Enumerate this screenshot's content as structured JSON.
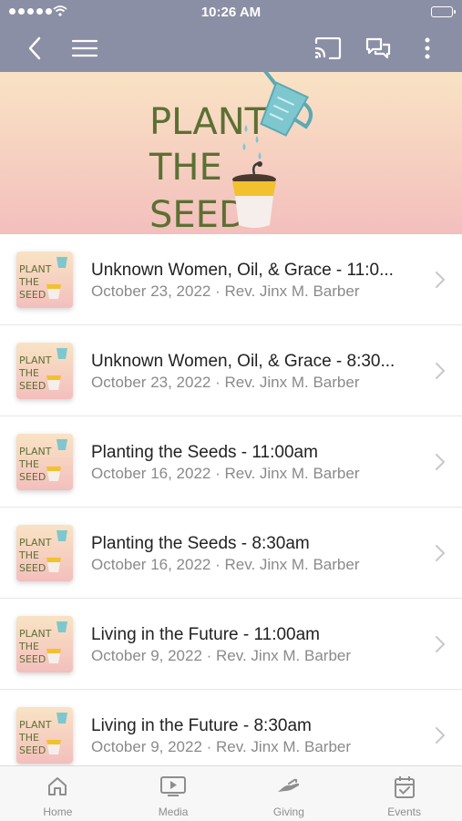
{
  "status_bar": {
    "time": "10:26 AM"
  },
  "header": {
    "brand_color": "#8b8fa5"
  },
  "banner": {
    "logo_text": "PLANT THE SEED"
  },
  "sermons": [
    {
      "title": "Unknown Women, Oil, & Grace - 11:0...",
      "subtitle": "October 23, 2022 · Rev. Jinx M. Barber"
    },
    {
      "title": "Unknown Women, Oil, & Grace - 8:30...",
      "subtitle": "October 23, 2022 · Rev. Jinx M. Barber"
    },
    {
      "title": "Planting the Seeds - 11:00am",
      "subtitle": "October 16, 2022 · Rev. Jinx M. Barber"
    },
    {
      "title": "Planting the Seeds - 8:30am",
      "subtitle": "October 16, 2022 · Rev. Jinx M. Barber"
    },
    {
      "title": "Living in the Future - 11:00am",
      "subtitle": "October 9, 2022 · Rev. Jinx M. Barber"
    },
    {
      "title": "Living in the Future - 8:30am",
      "subtitle": "October 9, 2022 · Rev. Jinx M. Barber"
    }
  ],
  "tabs": [
    {
      "label": "Home",
      "icon": "home-icon"
    },
    {
      "label": "Media",
      "icon": "media-icon"
    },
    {
      "label": "Giving",
      "icon": "giving-icon"
    },
    {
      "label": "Events",
      "icon": "events-icon"
    }
  ]
}
